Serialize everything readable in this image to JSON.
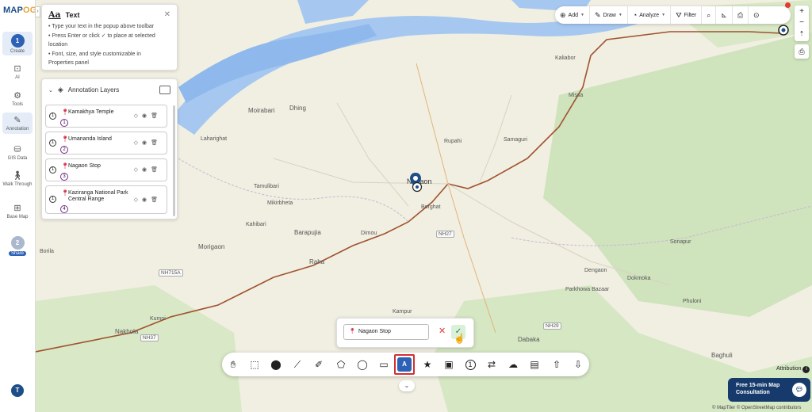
{
  "app": {
    "logo_main": "MAP",
    "logo_accent": "OG",
    "accent_color": "#2d61b6"
  },
  "rail": {
    "create": {
      "step": "1",
      "label": "Create"
    },
    "items": [
      {
        "label": "AI",
        "icon": "ai-icon"
      },
      {
        "label": "Tools",
        "icon": "tools-icon"
      },
      {
        "label": "Annotation",
        "icon": "annotation-icon"
      },
      {
        "label": "GIS Data",
        "icon": "gis-data-icon"
      },
      {
        "label": "Walk Through",
        "icon": "walk-through-icon"
      },
      {
        "label": "Base Map",
        "icon": "base-map-icon"
      }
    ],
    "share": {
      "step": "2",
      "label": "Share"
    },
    "user_initial": "T"
  },
  "text_popup": {
    "title": "Text",
    "lines": [
      "• Type your text in the popup above toolbar",
      "• Press Enter or click ✓ to place at selected",
      "location",
      "• Font, size, and style customizable in",
      "Properties panel"
    ]
  },
  "annotation_panel": {
    "title": "Annotation Layers",
    "items": [
      {
        "num": "1",
        "name": "Kamakhya Temple",
        "badge": "1"
      },
      {
        "num": "1",
        "name": "Umananda Island",
        "badge": "2"
      },
      {
        "num": "1",
        "name": "Nagaon Stop",
        "badge": "3"
      },
      {
        "num": "1",
        "name": "Kaziranga National Park Central Range",
        "badge": "4"
      }
    ]
  },
  "top_toolbar": {
    "add": "Add",
    "draw": "Draw",
    "analyze": "Analyze",
    "filter": "Filter"
  },
  "zoom": {
    "plus": "+",
    "minus": "−"
  },
  "name_popup": {
    "value": "Nagaon Stop"
  },
  "bottom_toolbar": {
    "tools": [
      "pan-hand",
      "select",
      "marker",
      "line",
      "measure",
      "polygon",
      "circle",
      "rectangle",
      "text",
      "star",
      "image",
      "number",
      "route",
      "shape",
      "building",
      "upload",
      "download"
    ],
    "active": "text",
    "active_glyph": "A",
    "number_glyph": "1"
  },
  "attribution": "Attribution",
  "consult": {
    "line1": "Free 15-min Map",
    "line2": "Consultation"
  },
  "copyright": "© MapTiler © OpenStreetMap contributors",
  "map_labels": [
    {
      "text": "Moirabari"
    },
    {
      "text": "Dhing"
    },
    {
      "text": "Laharighat"
    },
    {
      "text": "Rupahi"
    },
    {
      "text": "Samaguri"
    },
    {
      "text": "Kaliabor"
    },
    {
      "text": "Missa"
    },
    {
      "text": "Tamulibari"
    },
    {
      "text": "Mikirbheta"
    },
    {
      "text": "Nagaon"
    },
    {
      "text": "Borghat"
    },
    {
      "text": "Kahibari"
    },
    {
      "text": "Barapujia"
    },
    {
      "text": "Dimou"
    },
    {
      "text": "Morigaon"
    },
    {
      "text": "Raha"
    },
    {
      "text": "Borila"
    },
    {
      "text": "Sonapur"
    },
    {
      "text": "Dengaon"
    },
    {
      "text": "Dokmoka"
    },
    {
      "text": "Parkhowa Bazaar"
    },
    {
      "text": "Phuloni"
    },
    {
      "text": "Kumoi"
    },
    {
      "text": "Nakhola"
    },
    {
      "text": "Kampur"
    },
    {
      "text": "Dabaka"
    },
    {
      "text": "Baghuli"
    }
  ],
  "road_shields": [
    "NH27",
    "NH715A",
    "NH29",
    "NH37"
  ]
}
